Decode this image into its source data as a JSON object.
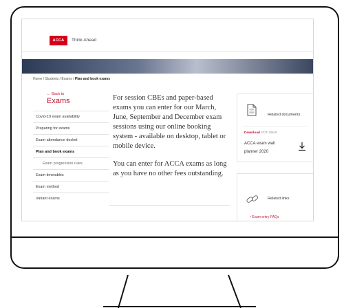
{
  "header": {
    "logo_text": "ACCA",
    "tagline": "Think Ahead"
  },
  "breadcrumb": {
    "path": "Home / Students / Exams / ",
    "current": "Plan and book exams"
  },
  "sidebar": {
    "back_label": "← Back to",
    "title": "Exams",
    "items": [
      {
        "label": "Covid-19 exam availability"
      },
      {
        "label": "Preparing for exams"
      },
      {
        "label": "Exam attendance docket"
      },
      {
        "label": "Plan and book exams"
      },
      {
        "label": "Exam progression rules"
      },
      {
        "label": "Exam timetables"
      },
      {
        "label": "Exam method"
      },
      {
        "label": "Variant exams"
      }
    ]
  },
  "main": {
    "paragraph1": "For session CBEs and paper-based exams you can enter for our March, June, September and December exam sessions using our online booking system - available on desktop, tablet or mobile device.",
    "paragraph2": "You can enter for ACCA exams as long as you have no other fees outstanding."
  },
  "related_documents": {
    "heading": "Related documents",
    "download_label": "Download",
    "file_meta": "PDF 85KB",
    "doc_title": "ACCA exam wall planner 2020"
  },
  "related_links": {
    "heading": "Related links",
    "items": [
      {
        "label": "Exam entry FAQs"
      }
    ]
  },
  "colors": {
    "brand_red": "#d4001a",
    "link_red": "#c8102e"
  }
}
